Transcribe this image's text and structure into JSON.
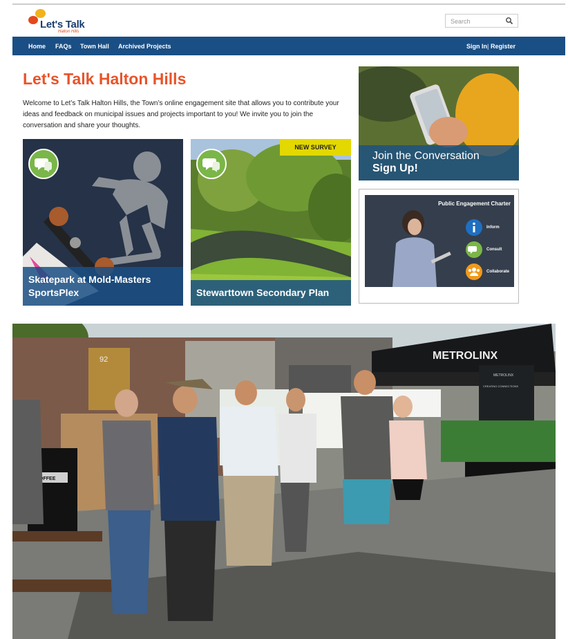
{
  "header": {
    "logo_text": "Let's Talk",
    "logo_sub": "Halton Hills",
    "search_placeholder": "Search"
  },
  "nav": {
    "items": [
      "Home",
      "FAQs",
      "Town Hall",
      "Archived Projects"
    ],
    "sign_in": "Sign In",
    "separator": "|",
    "register": "Register"
  },
  "main": {
    "title": "Let's Talk Halton Hills",
    "intro": "Welcome to Let’s Talk Halton Hills, the Town’s online engagement site that allows you to contribute your ideas and feedback on municipal issues and projects important to you! We invite you to join the conversation and share your thoughts.",
    "projects": [
      {
        "title": "Skatepark at Mold-Masters SportsPlex",
        "tag": ""
      },
      {
        "title": "Stewarttown Secondary Plan",
        "tag": "NEW SURVEY"
      }
    ]
  },
  "sidebar": {
    "join_line1": "Join the Conversation",
    "join_line2": "Sign Up!",
    "charter_title": "Public Engagement Charter",
    "charter_items": [
      "Inform",
      "Consult",
      "Collaborate"
    ]
  },
  "photo": {
    "tent_text": "METROLINX",
    "banner_text": "METROLINX",
    "banner_sub": "CREATING CONNECTIONS",
    "urn_label": "COFFEE",
    "house_number": "92"
  },
  "colors": {
    "brand_orange": "#e8542a",
    "nav_blue": "#1a4f85",
    "bubble_green": "#7ab648",
    "tag_yellow": "#e3d800"
  }
}
